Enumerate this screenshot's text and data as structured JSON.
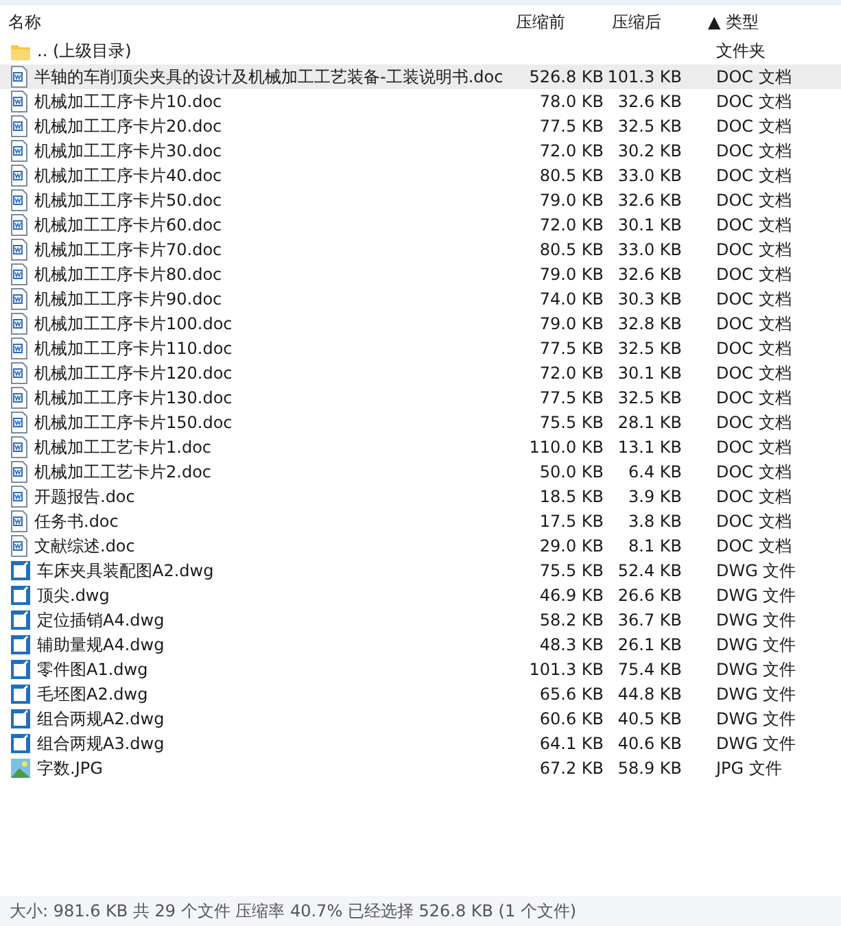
{
  "columns": [
    {
      "label": "名称"
    },
    {
      "label": "压缩前"
    },
    {
      "label": "压缩后"
    },
    {
      "label": "▲ 类型"
    }
  ],
  "rows": [
    {
      "kind": "folder",
      "name": ".. (上级目录)",
      "type": "文件夹",
      "selected": false
    },
    {
      "kind": "doc",
      "name": "半轴的车削顶尖夹具的设计及机械加工工艺装备-工装说明书.doc",
      "before": "526.8 KB",
      "after": "101.3 KB",
      "type": "DOC 文档",
      "selected": true
    },
    {
      "kind": "doc",
      "name": "机械加工工序卡片10.doc",
      "before": "78.0 KB",
      "after": "32.6 KB",
      "type": "DOC 文档",
      "selected": false
    },
    {
      "kind": "doc",
      "name": "机械加工工序卡片20.doc",
      "before": "77.5 KB",
      "after": "32.5 KB",
      "type": "DOC 文档",
      "selected": false
    },
    {
      "kind": "doc",
      "name": "机械加工工序卡片30.doc",
      "before": "72.0 KB",
      "after": "30.2 KB",
      "type": "DOC 文档",
      "selected": false
    },
    {
      "kind": "doc",
      "name": "机械加工工序卡片40.doc",
      "before": "80.5 KB",
      "after": "33.0 KB",
      "type": "DOC 文档",
      "selected": false
    },
    {
      "kind": "doc",
      "name": "机械加工工序卡片50.doc",
      "before": "79.0 KB",
      "after": "32.6 KB",
      "type": "DOC 文档",
      "selected": false
    },
    {
      "kind": "doc",
      "name": "机械加工工序卡片60.doc",
      "before": "72.0 KB",
      "after": "30.1 KB",
      "type": "DOC 文档",
      "selected": false
    },
    {
      "kind": "doc",
      "name": "机械加工工序卡片70.doc",
      "before": "80.5 KB",
      "after": "33.0 KB",
      "type": "DOC 文档",
      "selected": false
    },
    {
      "kind": "doc",
      "name": "机械加工工序卡片80.doc",
      "before": "79.0 KB",
      "after": "32.6 KB",
      "type": "DOC 文档",
      "selected": false
    },
    {
      "kind": "doc",
      "name": "机械加工工序卡片90.doc",
      "before": "74.0 KB",
      "after": "30.3 KB",
      "type": "DOC 文档",
      "selected": false
    },
    {
      "kind": "doc",
      "name": "机械加工工序卡片100.doc",
      "before": "79.0 KB",
      "after": "32.8 KB",
      "type": "DOC 文档",
      "selected": false
    },
    {
      "kind": "doc",
      "name": "机械加工工序卡片110.doc",
      "before": "77.5 KB",
      "after": "32.5 KB",
      "type": "DOC 文档",
      "selected": false
    },
    {
      "kind": "doc",
      "name": "机械加工工序卡片120.doc",
      "before": "72.0 KB",
      "after": "30.1 KB",
      "type": "DOC 文档",
      "selected": false
    },
    {
      "kind": "doc",
      "name": "机械加工工序卡片130.doc",
      "before": "77.5 KB",
      "after": "32.5 KB",
      "type": "DOC 文档",
      "selected": false
    },
    {
      "kind": "doc",
      "name": "机械加工工序卡片150.doc",
      "before": "75.5 KB",
      "after": "28.1 KB",
      "type": "DOC 文档",
      "selected": false
    },
    {
      "kind": "doc",
      "name": "机械加工工艺卡片1.doc",
      "before": "110.0 KB",
      "after": "13.1 KB",
      "type": "DOC 文档",
      "selected": false
    },
    {
      "kind": "doc",
      "name": "机械加工工艺卡片2.doc",
      "before": "50.0 KB",
      "after": "6.4 KB",
      "type": "DOC 文档",
      "selected": false
    },
    {
      "kind": "doc",
      "name": "开题报告.doc",
      "before": "18.5 KB",
      "after": "3.9 KB",
      "type": "DOC 文档",
      "selected": false
    },
    {
      "kind": "doc",
      "name": "任务书.doc",
      "before": "17.5 KB",
      "after": "3.8 KB",
      "type": "DOC 文档",
      "selected": false
    },
    {
      "kind": "doc",
      "name": "文献综述.doc",
      "before": "29.0 KB",
      "after": "8.1 KB",
      "type": "DOC 文档",
      "selected": false
    },
    {
      "kind": "dwg",
      "name": "车床夹具装配图A2.dwg",
      "before": "75.5 KB",
      "after": "52.4 KB",
      "type": "DWG 文件",
      "selected": false
    },
    {
      "kind": "dwg",
      "name": "顶尖.dwg",
      "before": "46.9 KB",
      "after": "26.6 KB",
      "type": "DWG 文件",
      "selected": false
    },
    {
      "kind": "dwg",
      "name": "定位插销A4.dwg",
      "before": "58.2 KB",
      "after": "36.7 KB",
      "type": "DWG 文件",
      "selected": false
    },
    {
      "kind": "dwg",
      "name": "辅助量规A4.dwg",
      "before": "48.3 KB",
      "after": "26.1 KB",
      "type": "DWG 文件",
      "selected": false
    },
    {
      "kind": "dwg",
      "name": "零件图A1.dwg",
      "before": "101.3 KB",
      "after": "75.4 KB",
      "type": "DWG 文件",
      "selected": false
    },
    {
      "kind": "dwg",
      "name": "毛坯图A2.dwg",
      "before": "65.6 KB",
      "after": "44.8 KB",
      "type": "DWG 文件",
      "selected": false
    },
    {
      "kind": "dwg",
      "name": "组合两规A2.dwg",
      "before": "60.6 KB",
      "after": "40.5 KB",
      "type": "DWG 文件",
      "selected": false
    },
    {
      "kind": "dwg",
      "name": "组合两规A3.dwg",
      "before": "64.1 KB",
      "after": "40.6 KB",
      "type": "DWG 文件",
      "selected": false
    },
    {
      "kind": "jpg",
      "name": "字数.JPG",
      "before": "67.2 KB",
      "after": "58.9 KB",
      "type": "JPG 文件",
      "selected": false
    }
  ],
  "status_bar": "大小: 981.6 KB 共 29 个文件 压缩率 40.7% 已经选择 526.8 KB (1 个文件)"
}
